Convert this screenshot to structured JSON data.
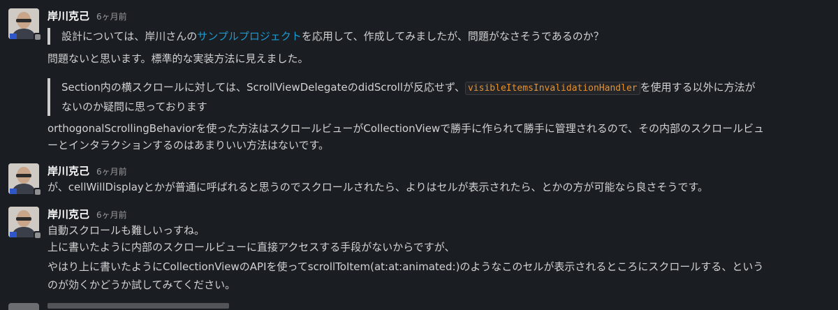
{
  "messages": [
    {
      "author": "岸川克己",
      "time": "6ヶ月前",
      "quote1_pre": "設計については、岸川さんの",
      "quote1_link": "サンプルプロジェクト",
      "quote1_post": "を応用して、作成してみましたが、問題がなさそうであるのか？",
      "reply1": "問題ないと思います。標準的な実装方法に見えました。",
      "quote2_pre": "Section内の横スクロールに対しては、ScrollViewDelegateのdidScrollが反応せず、",
      "quote2_code": "visibleItemsInvalidationHandler",
      "quote2_post": "を使用する以外に方法が",
      "quote2_line2": "ないのか疑問に思っております",
      "reply2_line1": "orthogonalScrollingBehaviorを使った方法はスクロールビューがCollectionViewで勝手に作られて勝手に管理されるので、その内部のスクロールビュ",
      "reply2_line2": "ーとインタラクションするのはあまりいい方法はないです。"
    },
    {
      "author": "岸川克己",
      "time": "6ヶ月前",
      "text": "が、cellWillDisplayとかが普通に呼ばれると思うのでスクロールされたら、よりはセルが表示されたら、とかの方が可能なら良さそうです。"
    },
    {
      "author": "岸川克己",
      "time": "6ヶ月前",
      "line1": "自動スクロールも難しいっすね。",
      "line2": "上に書いたように内部のスクロールビューに直接アクセスする手段がないからですが、",
      "line3": "やはり上に書いたようにCollectionViewのAPIを使ってscrollToItem(at:at:animated:)のようなこのセルが表示されるところにスクロールする、という",
      "line4": "のが効くかどうか試してみてください。"
    }
  ]
}
